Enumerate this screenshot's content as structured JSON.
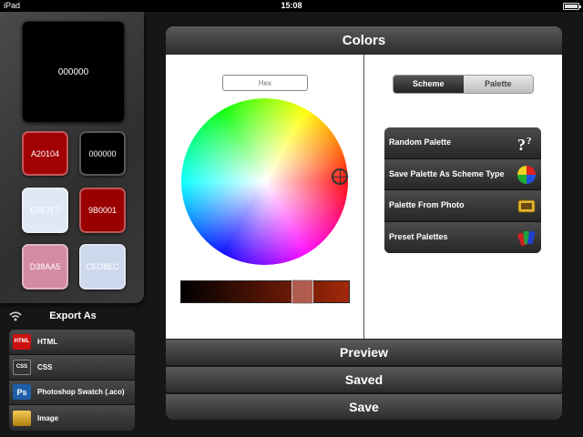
{
  "status_bar": {
    "carrier": "iPad",
    "time": "15:08"
  },
  "swatches": {
    "main": {
      "label": "000000",
      "color": "#000000"
    },
    "items": [
      {
        "label": "A20104",
        "color": "#A20104",
        "text_color": "#ffffff"
      },
      {
        "label": "000000",
        "color": "#000000",
        "text_color": "#ffffff"
      },
      {
        "label": "E0E7F7",
        "color": "#E0E7F7",
        "text_color": "#ffffff"
      },
      {
        "label": "9B0001",
        "color": "#9B0001",
        "text_color": "#ffffff"
      },
      {
        "label": "D38AA5",
        "color": "#D38AA5",
        "text_color": "#ffffff"
      },
      {
        "label": "CED8EC",
        "color": "#CED8EC",
        "text_color": "#ffffff"
      }
    ]
  },
  "export": {
    "title": "Export As",
    "items": [
      {
        "label": "HTML",
        "icon": "html-icon",
        "icon_text": "HTML",
        "icon_color": "#cc1111"
      },
      {
        "label": "CSS",
        "icon": "css-icon",
        "icon_text": "CSS",
        "icon_color": "#333333"
      },
      {
        "label": "Photoshop Swatch (.aco)",
        "icon": "photoshop-icon",
        "icon_text": "Ps",
        "icon_color": "#1e5fa8"
      },
      {
        "label": "Image",
        "icon": "image-icon",
        "icon_text": "",
        "icon_color": "#e0b020"
      }
    ]
  },
  "main": {
    "title": "Colors",
    "hex_placeholder": "Hex",
    "segments": [
      {
        "label": "Scheme",
        "active": true
      },
      {
        "label": "Palette",
        "active": false
      }
    ],
    "actions": [
      {
        "label": "Random Palette",
        "icon": "question-marks-icon"
      },
      {
        "label": "Save Palette As Scheme Type",
        "icon": "color-wheel-icon"
      },
      {
        "label": "Palette From Photo",
        "icon": "photo-icon"
      },
      {
        "label": "Preset Palettes",
        "icon": "swatch-book-icon"
      }
    ],
    "brightness_start": "#000000",
    "brightness_end": "#A3280A"
  },
  "buttons": {
    "preview": "Preview",
    "saved": "Saved",
    "save": "Save"
  }
}
